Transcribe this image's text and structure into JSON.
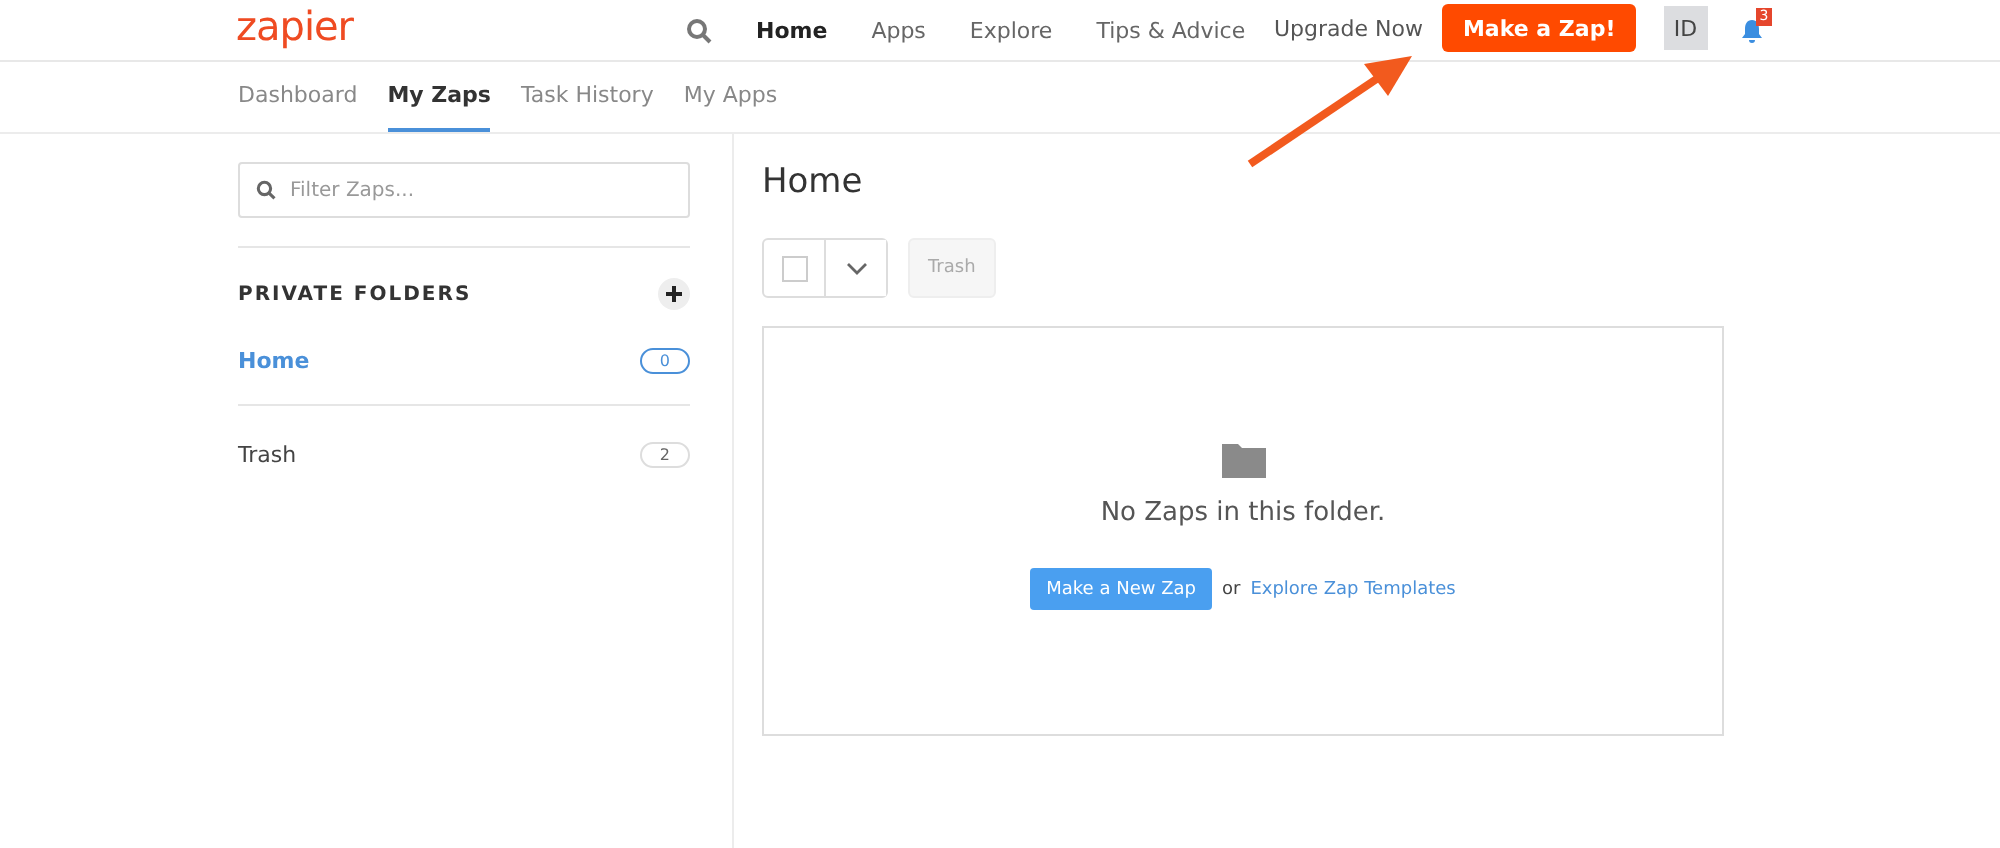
{
  "logo": "zapier",
  "nav": [
    {
      "label": "Home",
      "selected": true
    },
    {
      "label": "Apps",
      "selected": false
    },
    {
      "label": "Explore",
      "selected": false
    },
    {
      "label": "Tips & Advice",
      "selected": false
    }
  ],
  "upgrade": "Upgrade Now",
  "make_zap": "Make a Zap!",
  "avatar": "ID",
  "notifications": "3",
  "tabs": [
    {
      "label": "Dashboard",
      "selected": false
    },
    {
      "label": "My Zaps",
      "selected": true
    },
    {
      "label": "Task History",
      "selected": false
    },
    {
      "label": "My Apps",
      "selected": false
    }
  ],
  "sidebar": {
    "filter_placeholder": "Filter Zaps...",
    "section_title": "PRIVATE FOLDERS",
    "folders": [
      {
        "name": "Home",
        "count": "0",
        "selected": true
      },
      {
        "name": "Trash",
        "count": "2",
        "selected": false
      }
    ]
  },
  "main": {
    "title": "Home",
    "select_all_checked": false,
    "trash_button": "Trash",
    "trash_disabled": true,
    "empty_message": "No Zaps in this folder.",
    "new_zap_button": "Make a New Zap",
    "or_text": "or",
    "templates_link": "Explore Zap Templates"
  }
}
